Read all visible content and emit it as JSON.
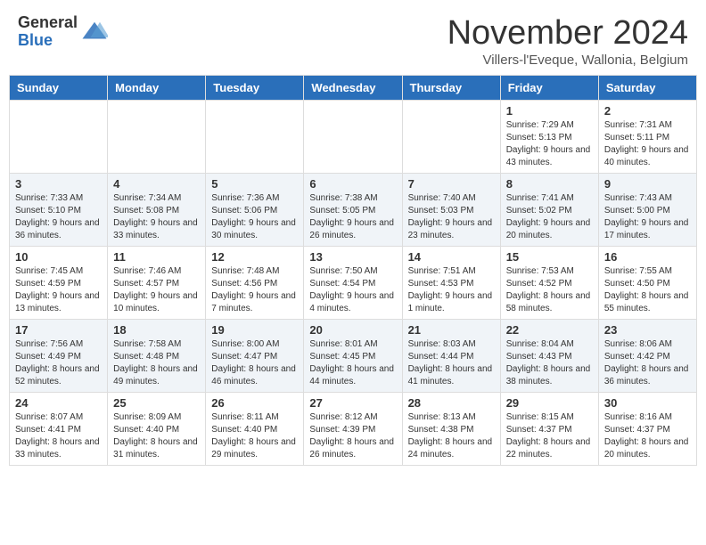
{
  "header": {
    "logo_general": "General",
    "logo_blue": "Blue",
    "month_title": "November 2024",
    "location": "Villers-l'Eveque, Wallonia, Belgium"
  },
  "days_of_week": [
    "Sunday",
    "Monday",
    "Tuesday",
    "Wednesday",
    "Thursday",
    "Friday",
    "Saturday"
  ],
  "weeks": [
    [
      {
        "day": "",
        "info": ""
      },
      {
        "day": "",
        "info": ""
      },
      {
        "day": "",
        "info": ""
      },
      {
        "day": "",
        "info": ""
      },
      {
        "day": "",
        "info": ""
      },
      {
        "day": "1",
        "info": "Sunrise: 7:29 AM\nSunset: 5:13 PM\nDaylight: 9 hours and 43 minutes."
      },
      {
        "day": "2",
        "info": "Sunrise: 7:31 AM\nSunset: 5:11 PM\nDaylight: 9 hours and 40 minutes."
      }
    ],
    [
      {
        "day": "3",
        "info": "Sunrise: 7:33 AM\nSunset: 5:10 PM\nDaylight: 9 hours and 36 minutes."
      },
      {
        "day": "4",
        "info": "Sunrise: 7:34 AM\nSunset: 5:08 PM\nDaylight: 9 hours and 33 minutes."
      },
      {
        "day": "5",
        "info": "Sunrise: 7:36 AM\nSunset: 5:06 PM\nDaylight: 9 hours and 30 minutes."
      },
      {
        "day": "6",
        "info": "Sunrise: 7:38 AM\nSunset: 5:05 PM\nDaylight: 9 hours and 26 minutes."
      },
      {
        "day": "7",
        "info": "Sunrise: 7:40 AM\nSunset: 5:03 PM\nDaylight: 9 hours and 23 minutes."
      },
      {
        "day": "8",
        "info": "Sunrise: 7:41 AM\nSunset: 5:02 PM\nDaylight: 9 hours and 20 minutes."
      },
      {
        "day": "9",
        "info": "Sunrise: 7:43 AM\nSunset: 5:00 PM\nDaylight: 9 hours and 17 minutes."
      }
    ],
    [
      {
        "day": "10",
        "info": "Sunrise: 7:45 AM\nSunset: 4:59 PM\nDaylight: 9 hours and 13 minutes."
      },
      {
        "day": "11",
        "info": "Sunrise: 7:46 AM\nSunset: 4:57 PM\nDaylight: 9 hours and 10 minutes."
      },
      {
        "day": "12",
        "info": "Sunrise: 7:48 AM\nSunset: 4:56 PM\nDaylight: 9 hours and 7 minutes."
      },
      {
        "day": "13",
        "info": "Sunrise: 7:50 AM\nSunset: 4:54 PM\nDaylight: 9 hours and 4 minutes."
      },
      {
        "day": "14",
        "info": "Sunrise: 7:51 AM\nSunset: 4:53 PM\nDaylight: 9 hours and 1 minute."
      },
      {
        "day": "15",
        "info": "Sunrise: 7:53 AM\nSunset: 4:52 PM\nDaylight: 8 hours and 58 minutes."
      },
      {
        "day": "16",
        "info": "Sunrise: 7:55 AM\nSunset: 4:50 PM\nDaylight: 8 hours and 55 minutes."
      }
    ],
    [
      {
        "day": "17",
        "info": "Sunrise: 7:56 AM\nSunset: 4:49 PM\nDaylight: 8 hours and 52 minutes."
      },
      {
        "day": "18",
        "info": "Sunrise: 7:58 AM\nSunset: 4:48 PM\nDaylight: 8 hours and 49 minutes."
      },
      {
        "day": "19",
        "info": "Sunrise: 8:00 AM\nSunset: 4:47 PM\nDaylight: 8 hours and 46 minutes."
      },
      {
        "day": "20",
        "info": "Sunrise: 8:01 AM\nSunset: 4:45 PM\nDaylight: 8 hours and 44 minutes."
      },
      {
        "day": "21",
        "info": "Sunrise: 8:03 AM\nSunset: 4:44 PM\nDaylight: 8 hours and 41 minutes."
      },
      {
        "day": "22",
        "info": "Sunrise: 8:04 AM\nSunset: 4:43 PM\nDaylight: 8 hours and 38 minutes."
      },
      {
        "day": "23",
        "info": "Sunrise: 8:06 AM\nSunset: 4:42 PM\nDaylight: 8 hours and 36 minutes."
      }
    ],
    [
      {
        "day": "24",
        "info": "Sunrise: 8:07 AM\nSunset: 4:41 PM\nDaylight: 8 hours and 33 minutes."
      },
      {
        "day": "25",
        "info": "Sunrise: 8:09 AM\nSunset: 4:40 PM\nDaylight: 8 hours and 31 minutes."
      },
      {
        "day": "26",
        "info": "Sunrise: 8:11 AM\nSunset: 4:40 PM\nDaylight: 8 hours and 29 minutes."
      },
      {
        "day": "27",
        "info": "Sunrise: 8:12 AM\nSunset: 4:39 PM\nDaylight: 8 hours and 26 minutes."
      },
      {
        "day": "28",
        "info": "Sunrise: 8:13 AM\nSunset: 4:38 PM\nDaylight: 8 hours and 24 minutes."
      },
      {
        "day": "29",
        "info": "Sunrise: 8:15 AM\nSunset: 4:37 PM\nDaylight: 8 hours and 22 minutes."
      },
      {
        "day": "30",
        "info": "Sunrise: 8:16 AM\nSunset: 4:37 PM\nDaylight: 8 hours and 20 minutes."
      }
    ]
  ]
}
